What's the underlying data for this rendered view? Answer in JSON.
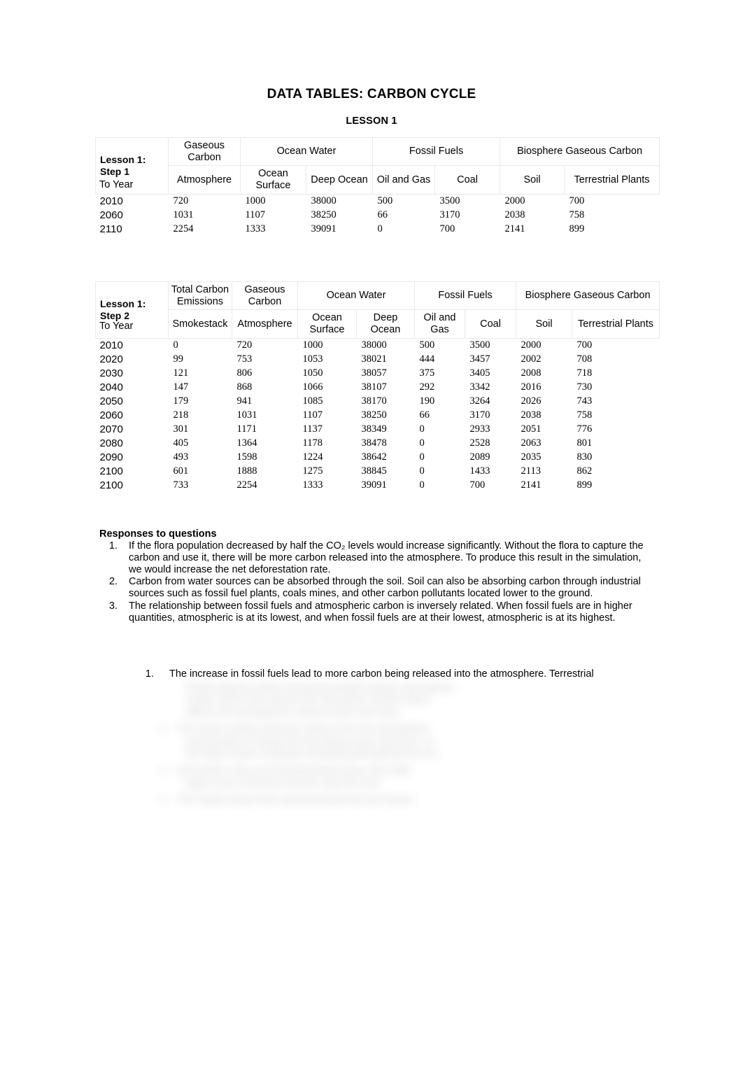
{
  "document": {
    "title": "DATA TABLES: CARBON CYCLE",
    "subtitle": "LESSON 1"
  },
  "table1": {
    "corner_label_line1": "Lesson 1:",
    "corner_label_line2": "Step 1",
    "row_header_label": "To Year",
    "group_headers": [
      {
        "label": "Gaseous Carbon",
        "span": 1
      },
      {
        "label": "Ocean Water",
        "span": 2
      },
      {
        "label": "Fossil Fuels",
        "span": 2
      },
      {
        "label": "Biosphere Gaseous Carbon",
        "span": 2
      }
    ],
    "sub_headers": [
      "Atmosphere",
      "Ocean Surface",
      "Deep Ocean",
      "Oil and Gas",
      "Coal",
      "Soil",
      "Terrestrial Plants"
    ],
    "rows": [
      {
        "year": "2010",
        "values": [
          "720",
          "1000",
          "38000",
          "500",
          "3500",
          "2000",
          "700"
        ]
      },
      {
        "year": "2060",
        "values": [
          "1031",
          "1107",
          "38250",
          "66",
          "3170",
          "2038",
          "758"
        ]
      },
      {
        "year": "2110",
        "values": [
          "2254",
          "1333",
          "39091",
          "0",
          "700",
          "2141",
          "899"
        ]
      }
    ]
  },
  "table2": {
    "corner_label_line1": "Lesson 1:",
    "corner_label_line2": "Step 2",
    "row_header_label": "To Year",
    "group_headers": [
      {
        "label": "Total Carbon Emissions",
        "span": 1
      },
      {
        "label": "Gaseous Carbon",
        "span": 1
      },
      {
        "label": "Ocean Water",
        "span": 2
      },
      {
        "label": "Fossil Fuels",
        "span": 2
      },
      {
        "label": "Biosphere Gaseous Carbon",
        "span": 2
      }
    ],
    "sub_headers": [
      "Smokestack",
      "Atmosphere",
      "Ocean Surface",
      "Deep Ocean",
      "Oil and Gas",
      "Coal",
      "Soil",
      "Terrestrial Plants"
    ],
    "rows": [
      {
        "year": "2010",
        "values": [
          "0",
          "720",
          "1000",
          "38000",
          "500",
          "3500",
          "2000",
          "700"
        ]
      },
      {
        "year": "2020",
        "values": [
          "99",
          "753",
          "1053",
          "38021",
          "444",
          "3457",
          "2002",
          "708"
        ]
      },
      {
        "year": "2030",
        "values": [
          "121",
          "806",
          "1050",
          "38057",
          "375",
          "3405",
          "2008",
          "718"
        ]
      },
      {
        "year": "2040",
        "values": [
          "147",
          "868",
          "1066",
          "38107",
          "292",
          "3342",
          "2016",
          "730"
        ]
      },
      {
        "year": "2050",
        "values": [
          "179",
          "941",
          "1085",
          "38170",
          "190",
          "3264",
          "2026",
          "743"
        ]
      },
      {
        "year": "2060",
        "values": [
          "218",
          "1031",
          "1107",
          "38250",
          "66",
          "3170",
          "2038",
          "758"
        ]
      },
      {
        "year": "2070",
        "values": [
          "301",
          "1171",
          "1137",
          "38349",
          "0",
          "2933",
          "2051",
          "776"
        ]
      },
      {
        "year": "2080",
        "values": [
          "405",
          "1364",
          "1178",
          "38478",
          "0",
          "2528",
          "2063",
          "801"
        ]
      },
      {
        "year": "2090",
        "values": [
          "493",
          "1598",
          "1224",
          "38642",
          "0",
          "2089",
          "2035",
          "830"
        ]
      },
      {
        "year": "2100",
        "values": [
          "601",
          "1888",
          "1275",
          "38845",
          "0",
          "1433",
          "2113",
          "862"
        ]
      },
      {
        "year": "2100",
        "values": [
          "733",
          "2254",
          "1333",
          "39091",
          "0",
          "700",
          "2141",
          "899"
        ]
      }
    ]
  },
  "responses": {
    "heading": "Responses to questions",
    "items": [
      {
        "number": "1.",
        "text": "If the flora population decreased by half the CO₂ levels would increase significantly. Without the flora to capture the carbon and use it, there will be more carbon released into the atmosphere. To produce this result in the simulation, we would increase the net deforestation rate."
      },
      {
        "number": "2.",
        "text": "Carbon from water sources can be absorbed through the soil. Soil can also be absorbing carbon through industrial sources such as fossil fuel plants, coals mines, and other carbon pollutants located lower to the ground."
      },
      {
        "number": "3.",
        "text": "The relationship between fossil fuels and atmospheric carbon is inversely related. When fossil fuels are in higher quantities, atmospheric is at its lowest, and when fossil fuels are at their lowest, atmospheric is at its highest."
      }
    ],
    "sub_items": [
      {
        "number": "1.",
        "text": "The increase in fossil fuels lead to more carbon being released into the atmosphere. Terrestrial"
      }
    ],
    "obscured_note": "[remaining text is blurred and illegible]"
  }
}
